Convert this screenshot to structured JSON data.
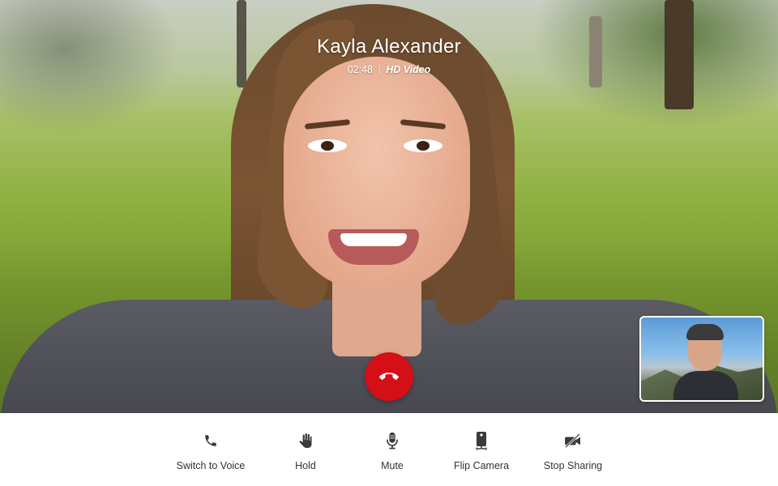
{
  "call": {
    "caller_name": "Kayla Alexander",
    "duration": "02:48",
    "separator": "|",
    "quality": "HD Video"
  },
  "end_call": {
    "icon": "phone-hangup-icon",
    "color": "#d50f16"
  },
  "toolbar": {
    "items": [
      {
        "label": "Switch to Voice",
        "icon": "phone-icon"
      },
      {
        "label": "Hold",
        "icon": "hand-icon"
      },
      {
        "label": "Mute",
        "icon": "microphone-icon"
      },
      {
        "label": "Flip Camera",
        "icon": "flip-camera-icon"
      },
      {
        "label": "Stop Sharing",
        "icon": "video-off-icon"
      }
    ]
  }
}
